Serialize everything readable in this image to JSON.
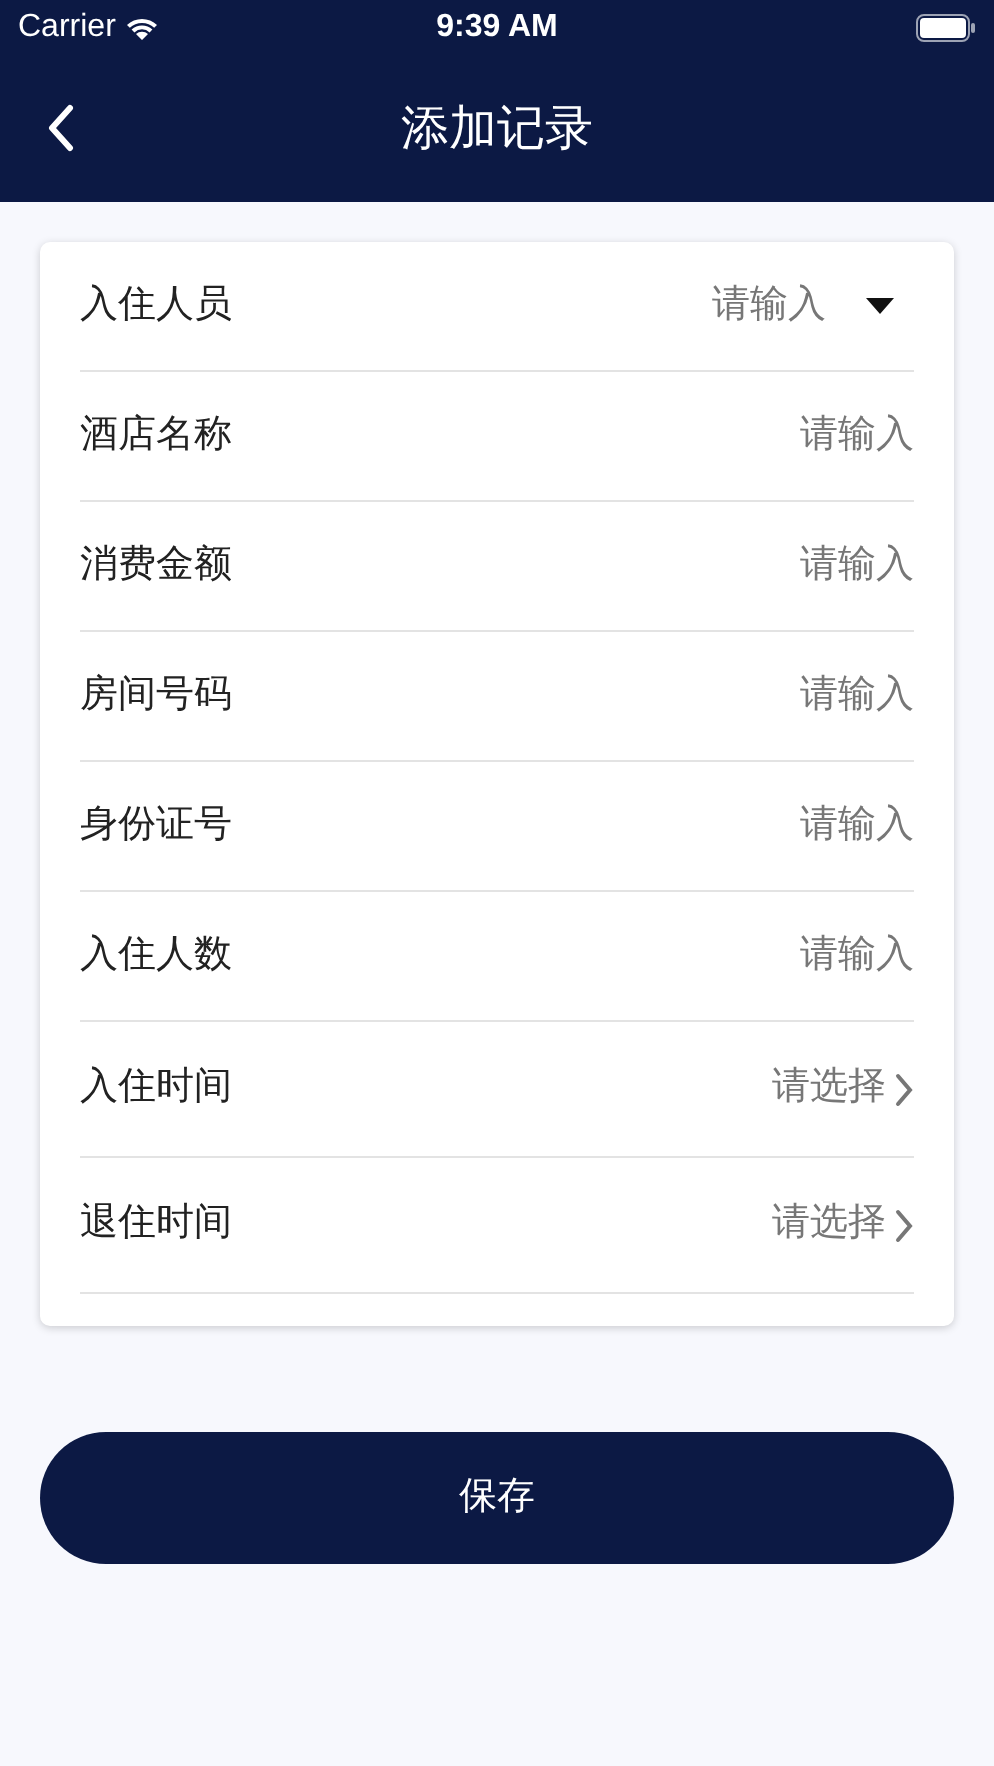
{
  "status_bar": {
    "carrier": "Carrier",
    "time": "9:39 AM"
  },
  "nav_bar": {
    "title": "添加记录"
  },
  "form": {
    "rows": [
      {
        "kind": "dropdown",
        "label": "入住人员",
        "placeholder": "请输入"
      },
      {
        "kind": "input",
        "label": "酒店名称",
        "placeholder": "请输入"
      },
      {
        "kind": "input",
        "label": "消费金额",
        "placeholder": "请输入"
      },
      {
        "kind": "input",
        "label": "房间号码",
        "placeholder": "请输入"
      },
      {
        "kind": "input",
        "label": "身份证号",
        "placeholder": "请输入"
      },
      {
        "kind": "input",
        "label": "入住人数",
        "placeholder": "请输入"
      },
      {
        "kind": "select",
        "label": "入住时间",
        "value": "请选择"
      },
      {
        "kind": "select",
        "label": "退住时间",
        "value": "请选择"
      }
    ]
  },
  "save_button": {
    "label": "保存"
  }
}
